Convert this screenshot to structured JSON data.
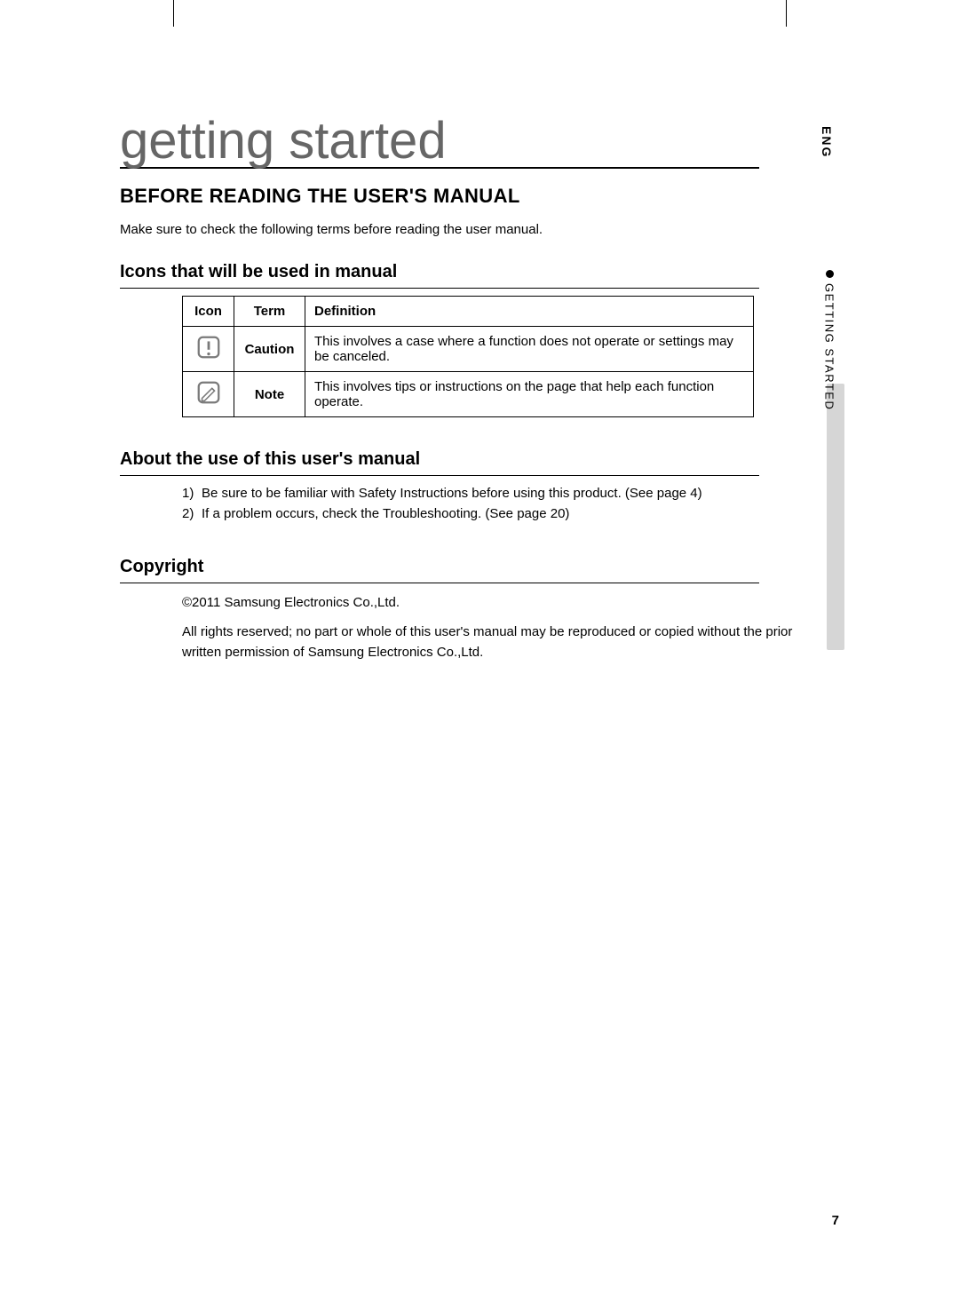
{
  "chapter_title": "getting started",
  "section_heading": "BEFORE READING THE USER'S MANUAL",
  "intro_line": "Make sure to check the following terms before reading the user manual.",
  "icons_table": {
    "heading": "Icons that will be used in manual",
    "columns": {
      "icon": "Icon",
      "term": "Term",
      "definition": "Definition"
    },
    "rows": [
      {
        "icon_name": "caution-icon",
        "term": "Caution",
        "definition": "This involves a case where a function does not operate or settings may be canceled."
      },
      {
        "icon_name": "note-icon",
        "term": "Note",
        "definition": "This involves tips or instructions on the page that help each function operate."
      }
    ]
  },
  "about_use": {
    "heading": "About the use of this user's manual",
    "items": [
      "Be sure to be familiar with Safety Instructions before using this product. (See page 4)",
      "If a problem occurs, check the Troubleshooting. (See page 20)"
    ]
  },
  "copyright": {
    "heading": "Copyright",
    "line1": "©2011 Samsung Electronics Co.,Ltd.",
    "line2": "All rights reserved; no part or whole of this user's manual may be reproduced or copied without the prior written permission of Samsung Electronics Co.,Ltd."
  },
  "side": {
    "lang": "ENG",
    "section": "GETTING STARTED"
  },
  "page_number": "7"
}
